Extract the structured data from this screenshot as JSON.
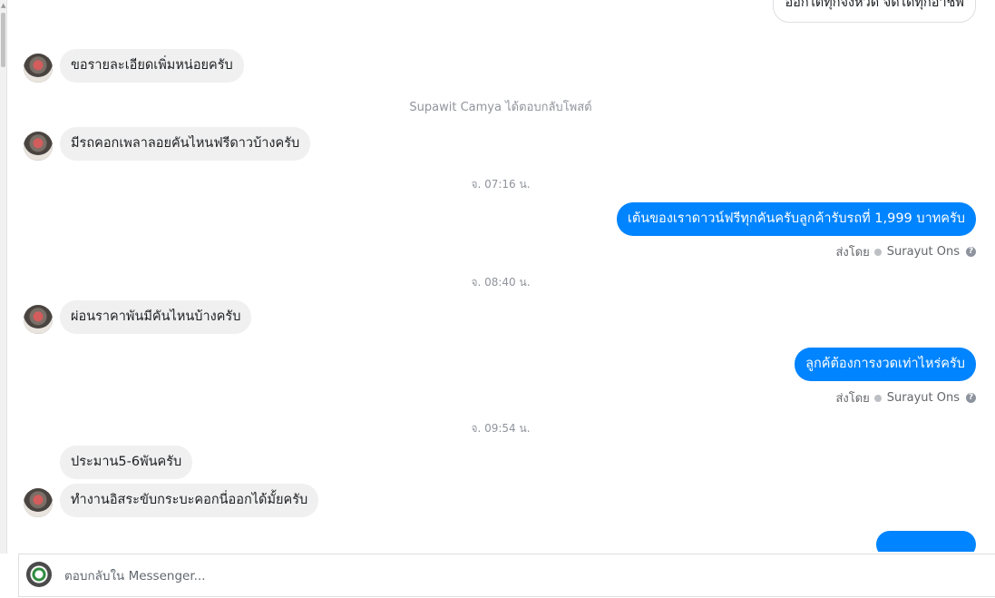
{
  "thread": {
    "top_partial_message": "ออกใต้ทุกจังหวัด จัดได้ทุกอาชีพ",
    "items": [
      {
        "kind": "in",
        "text": "ขอรายละเอียดเพิ่มหน่อยครับ"
      },
      {
        "kind": "system",
        "text": "Supawit Camya ได้ตอบกลับโพสต์"
      },
      {
        "kind": "in",
        "text": "มีรถคอกเพลาลอยคันไหนฟรีดาวบ้างครับ"
      },
      {
        "kind": "time",
        "text": "จ. 07:16 น."
      },
      {
        "kind": "out",
        "text": "เต้นของเราดาวน์ฟรีทุกคันครับลูกค้ารับรถที่ 1,999 บาทครับ"
      },
      {
        "kind": "sent",
        "prefix": "ส่งโดย",
        "name": "Surayut Ons"
      },
      {
        "kind": "time",
        "text": "จ. 08:40 น."
      },
      {
        "kind": "in",
        "text": "ผ่อนราคาพันมีคันไหนบ้างครับ"
      },
      {
        "kind": "out",
        "text": "ลูกค้ต้องการงวดเท่าไหร่ครับ"
      },
      {
        "kind": "sent",
        "prefix": "ส่งโดย",
        "name": "Surayut Ons"
      },
      {
        "kind": "time",
        "text": "จ. 09:54 น."
      },
      {
        "kind": "in",
        "text": "ประมาน5-6พันครับ"
      },
      {
        "kind": "in",
        "text": "ทำงานอิสระขับกระบะคอกนี่ออกได้มั้ยครับ"
      }
    ]
  },
  "composer": {
    "placeholder": "ตอบกลับใน Messenger..."
  },
  "colors": {
    "outgoing_bubble": "#0084ff",
    "incoming_bubble": "#f0f0f0",
    "meta_text": "#90949c"
  },
  "icons": {
    "sent_status": "check-circle-icon",
    "help": "question-circle-icon"
  }
}
